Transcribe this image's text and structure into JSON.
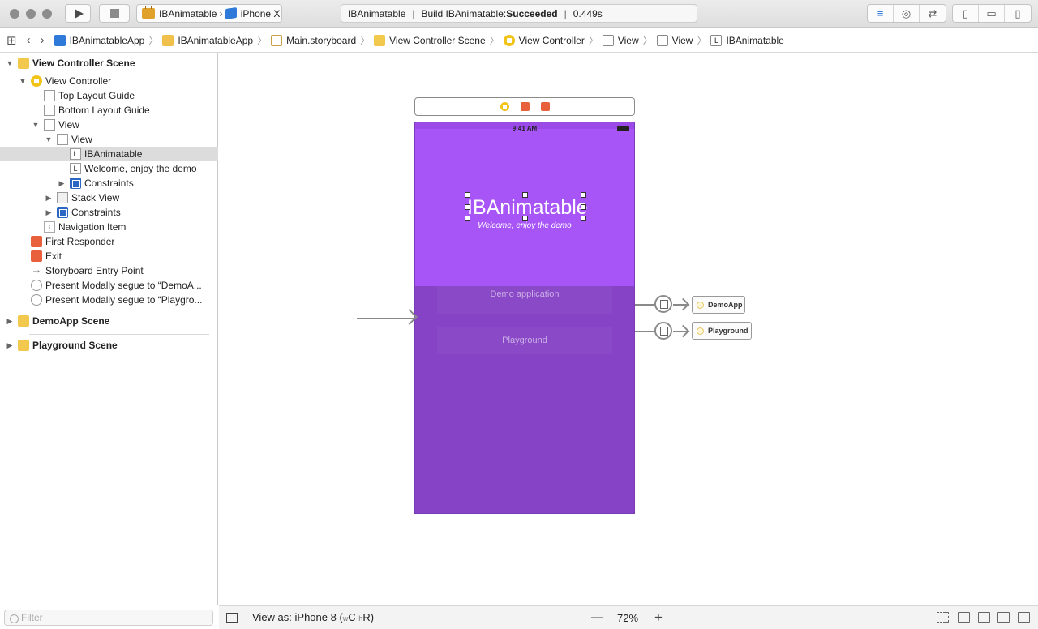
{
  "toolbar": {
    "scheme_app": "IBAnimatable",
    "scheme_device": "iPhone X",
    "activity_project": "IBAnimatable",
    "activity_build": "Build IBAnimatable: ",
    "activity_status": "Succeeded",
    "activity_time": "0.449s"
  },
  "jumpbar": {
    "crumbs": [
      "IBAnimatableApp",
      "IBAnimatableApp",
      "Main.storyboard",
      "View Controller Scene",
      "View Controller",
      "View",
      "View",
      "IBAnimatable"
    ]
  },
  "outline": {
    "rows": [
      "View Controller Scene",
      "View Controller",
      "Top Layout Guide",
      "Bottom Layout Guide",
      "View",
      "View",
      "IBAnimatable",
      "Welcome, enjoy the demo",
      "Constraints",
      "Stack View",
      "Constraints",
      "Navigation Item",
      "First Responder",
      "Exit",
      "Storyboard Entry Point",
      "Present Modally segue to “DemoA...",
      "Present Modally segue to “Playgro...",
      "DemoApp Scene",
      "Playground Scene"
    ],
    "label_icon": "L",
    "filter_placeholder": "Filter"
  },
  "canvas": {
    "status_time": "9:41 AM",
    "title": "IBAnimatable",
    "subtitle": "Welcome, enjoy the demo",
    "button1": "Demo application",
    "button2": "Playground",
    "dest1": "DemoApp",
    "dest2": "Playground",
    "colors": {
      "top_bg": "#a855f7",
      "bottom_bg": "#8743c6"
    }
  },
  "bottombar": {
    "view_as": "View as: iPhone 8 (",
    "size_w": "w",
    "size_c": "C",
    "size_h": "h",
    "size_r": "R",
    "close_paren": ")",
    "zoom": "72%",
    "zoom_out": "—",
    "zoom_in": "+"
  }
}
